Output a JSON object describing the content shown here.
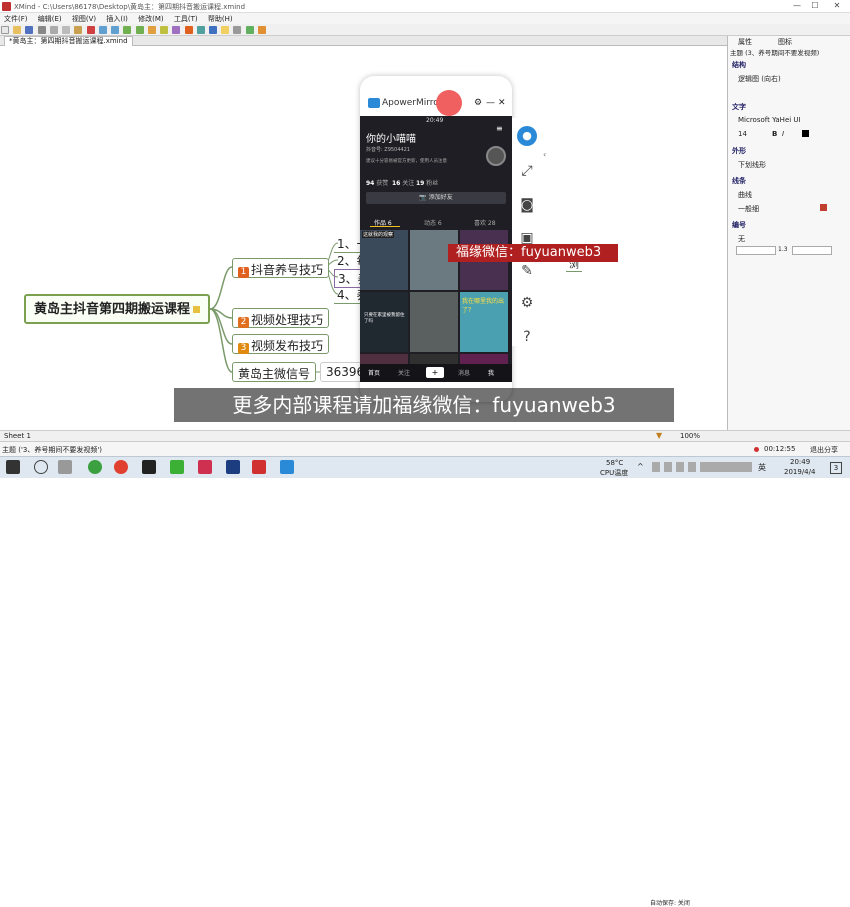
{
  "window": {
    "title": "XMind - C:\\Users\\86178\\Desktop\\黄岛主：第四期抖音搬运课程.xmind"
  },
  "menu": [
    "文件(F)",
    "编辑(E)",
    "视图(V)",
    "插入(I)",
    "修改(M)",
    "工具(T)",
    "帮助(H)"
  ],
  "tab": {
    "label": "*黄岛主：第四期抖音搬运课程.xmind"
  },
  "mindmap": {
    "root": "黄岛主抖音第四期搬运课程",
    "branches": [
      {
        "num": "1",
        "label": "抖音养号技巧",
        "color": "#e06020"
      },
      {
        "num": "2",
        "label": "视频处理技巧",
        "color": "#e07020"
      },
      {
        "num": "3",
        "label": "视频发布技巧",
        "color": "#e08a10"
      },
      {
        "num": "",
        "label": "黄岛主微信号",
        "color": ""
      }
    ],
    "subitems": [
      "1、一",
      "2、每",
      "3、养",
      "4、养"
    ],
    "wechat_value": "36396",
    "side_text": "浏"
  },
  "phone": {
    "app_name": "ApowerMirror",
    "time": "20:49",
    "profile_name": "你的小喵喵",
    "douyin_id": "抖音号: Z9504421",
    "bio": "建议十分容易被官方更新，使用人员注意",
    "stats": [
      {
        "value": "94",
        "label": "获赞"
      },
      {
        "value": "16",
        "label": "关注"
      },
      {
        "value": "19",
        "label": "粉丝"
      }
    ],
    "add_friend": "添加好友",
    "tabs": [
      {
        "label": "作品 6"
      },
      {
        "label": "动态 6"
      },
      {
        "label": "喜欢 28"
      }
    ],
    "first_label": "这就我的观察",
    "overlay_label": "只要在家里被我留住了吗",
    "cell_text": "我在哪里我的出了？",
    "bottom_nav": [
      "首页",
      "关注",
      "+",
      "消息",
      "我"
    ]
  },
  "watermark": "福缘微信：fuyuanweb3",
  "caption": "更多内部课程请加福缘微信：fuyuanweb3",
  "sidebar": {
    "tabs": [
      "属性",
      "图标"
    ],
    "header": "主题 (3、养号期间不要发视频)",
    "sections": {
      "structure": {
        "title": "结构",
        "value": "逻辑图 (向右)"
      },
      "text": {
        "title": "文字",
        "font": "Microsoft YaHei UI",
        "size": "14"
      },
      "shape": {
        "title": "外形",
        "value": "下划线形"
      },
      "line": {
        "title": "线条",
        "curve": "曲线",
        "weight": "一般细"
      },
      "numbering": {
        "title": "编号",
        "value": "无",
        "depth": "1.3"
      }
    }
  },
  "sheet": {
    "label": "Sheet 1",
    "zoom": "100%"
  },
  "status": {
    "text": "主题 ('3、养号期间不要发视频')"
  },
  "recording": {
    "time": "00:12:55",
    "exit": "退出分享"
  },
  "taskbar": {
    "weather": "58°C",
    "cpu": "CPU温度",
    "autosave": "自动保存: 关闭",
    "lang": "英",
    "clock_time": "20:49",
    "clock_date": "2019/4/4",
    "notif": "3"
  }
}
